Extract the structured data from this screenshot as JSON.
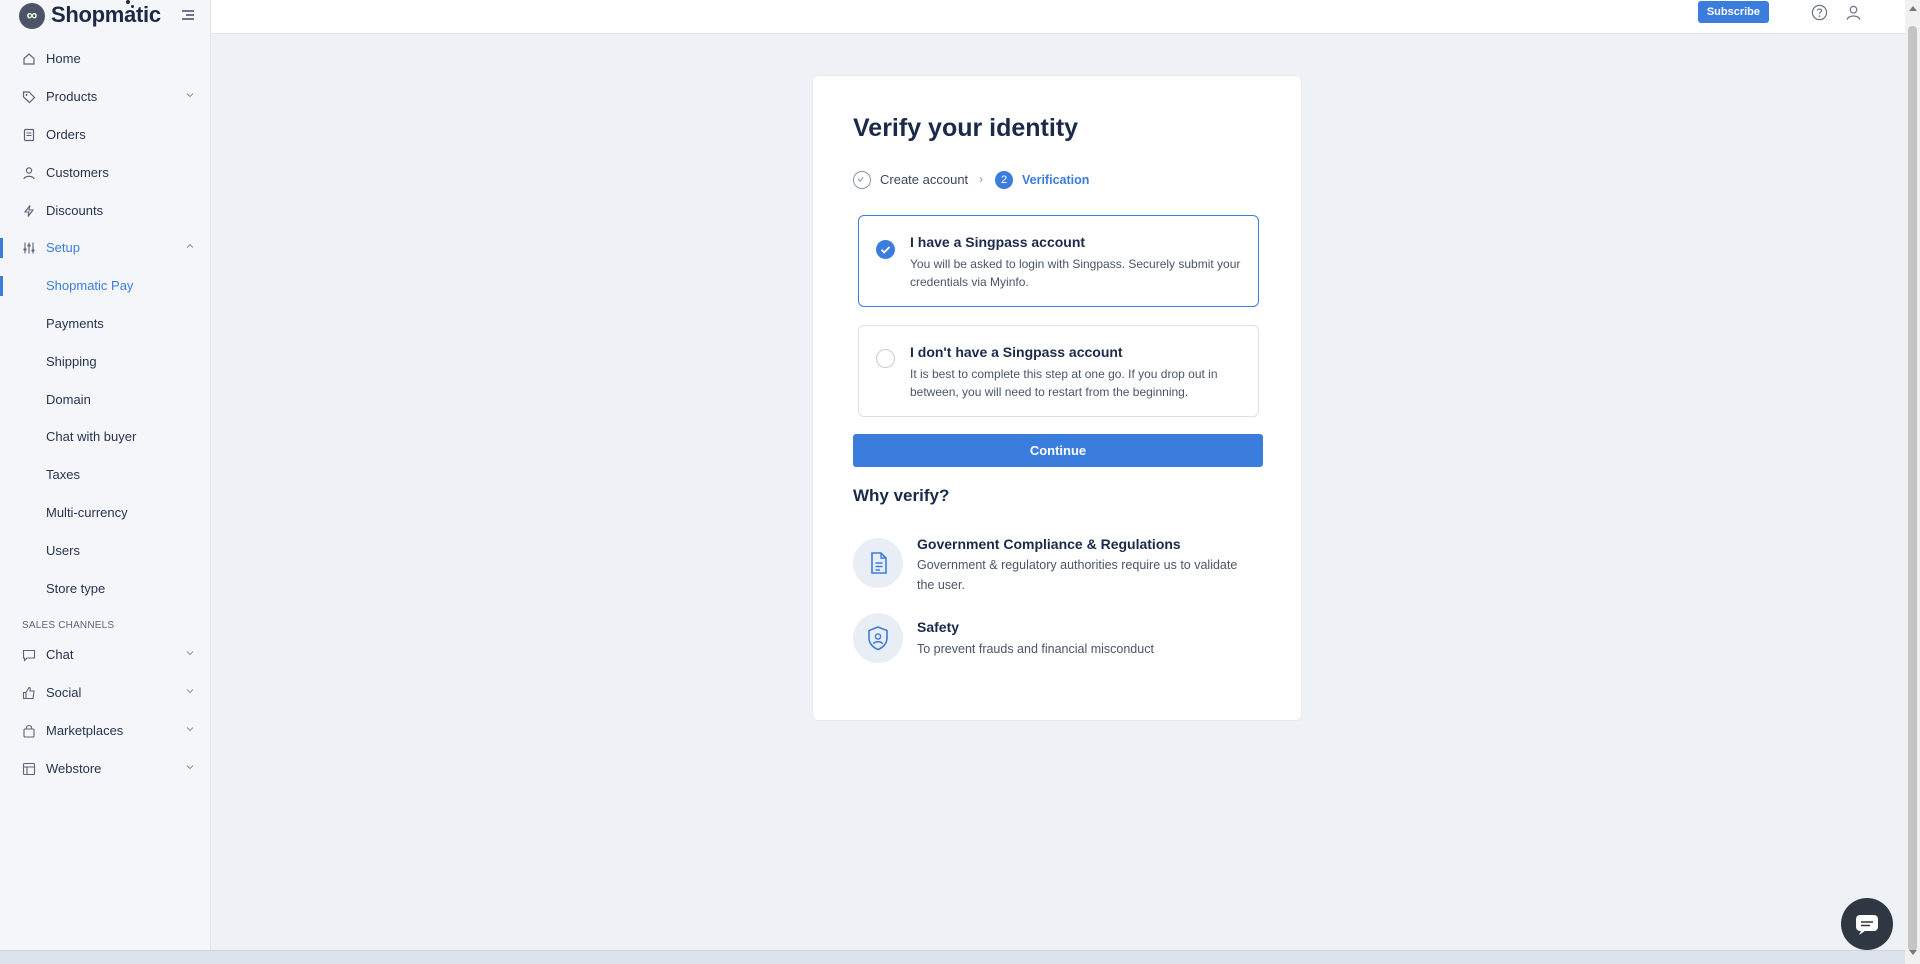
{
  "app": {
    "name": "Shopmatic"
  },
  "sidebar": {
    "items": [
      {
        "label": "Home",
        "icon": "home-icon"
      },
      {
        "label": "Products",
        "icon": "tag-icon"
      },
      {
        "label": "Orders",
        "icon": "orders-icon"
      },
      {
        "label": "Customers",
        "icon": "user-icon"
      },
      {
        "label": "Discounts",
        "icon": "bolt-icon"
      },
      {
        "label": "Setup",
        "icon": "sliders-icon"
      }
    ],
    "setup_sub": [
      {
        "label": "Shopmatic Pay"
      },
      {
        "label": "Payments"
      },
      {
        "label": "Shipping"
      },
      {
        "label": "Domain"
      },
      {
        "label": "Chat with buyer"
      },
      {
        "label": "Taxes"
      },
      {
        "label": "Multi-currency"
      },
      {
        "label": "Users"
      },
      {
        "label": "Store type"
      }
    ],
    "sales_channels_heading": "SALES CHANNELS",
    "channels": [
      {
        "label": "Chat",
        "icon": "chat-icon"
      },
      {
        "label": "Social",
        "icon": "thumbs-up-icon"
      },
      {
        "label": "Marketplaces",
        "icon": "bag-icon"
      },
      {
        "label": "Webstore",
        "icon": "layout-icon"
      }
    ]
  },
  "topbar": {
    "subscribe_label": "Subscribe"
  },
  "verify": {
    "title": "Verify your identity",
    "steps": [
      {
        "label": "Create account",
        "state": "done"
      },
      {
        "number": "2",
        "label": "Verification",
        "state": "current"
      }
    ],
    "options": [
      {
        "title": "I have a Singpass account",
        "description": "You will be asked to login with Singpass. Securely submit your credentials via Myinfo.",
        "selected": true
      },
      {
        "title": "I don't have a Singpass account",
        "description": "It is best to complete this step at one go. If you drop out in between, you will need to restart from the beginning.",
        "selected": false
      }
    ],
    "continue_label": "Continue",
    "why_title": "Why verify?",
    "reasons": [
      {
        "title": "Government Compliance & Regulations",
        "description": "Government & regulatory authorities require us to validate the user.",
        "icon": "document-icon"
      },
      {
        "title": "Safety",
        "description": "To prevent frauds and financial misconduct",
        "icon": "shield-user-icon"
      }
    ]
  },
  "colors": {
    "accent": "#3b7ddd",
    "sidebar_bg": "#f4f6f9",
    "page_bg": "#eef1f5"
  }
}
